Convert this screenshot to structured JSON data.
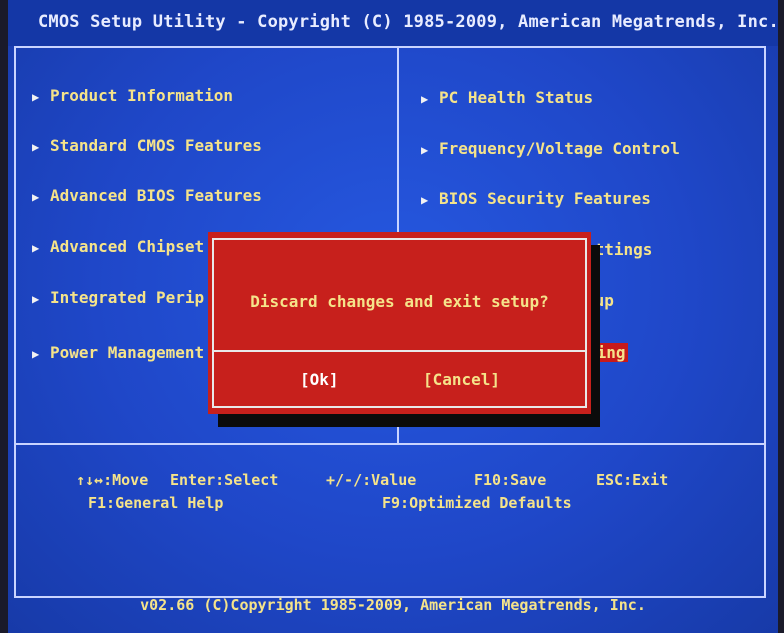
{
  "header": {
    "title": "CMOS Setup Utility - Copyright (C) 1985-2009, American Megatrends, Inc."
  },
  "left_menu": [
    {
      "label": "Product Information"
    },
    {
      "label": "Standard CMOS Features"
    },
    {
      "label": "Advanced BIOS Features"
    },
    {
      "label": "Advanced Chipset"
    },
    {
      "label": "Integrated Perip"
    },
    {
      "label": "Power Management"
    }
  ],
  "right_menu": [
    {
      "label": "PC Health Status"
    },
    {
      "label": "Frequency/Voltage Control"
    },
    {
      "label": "BIOS Security Features"
    },
    {
      "label": "ettings"
    },
    {
      "label": "tup"
    },
    {
      "label": "ving"
    }
  ],
  "dialog": {
    "message": "Discard changes and exit setup?",
    "ok_label": "[Ok]",
    "cancel_label": "[Cancel]"
  },
  "help": {
    "row1": {
      "move": "↑↓↔:Move",
      "select": "Enter:Select",
      "value": "+/-/:Value",
      "save": "F10:Save",
      "exit": "ESC:Exit"
    },
    "row2": {
      "general_help": "F1:General Help",
      "defaults": "F9:Optimized Defaults"
    }
  },
  "footer": {
    "version": "v02.66 (C)Copyright 1985-2009, American Megatrends, Inc."
  },
  "colors": {
    "background": "#1e45c6",
    "menu_text": "#f5e38a",
    "dialog": "#c7201c",
    "selected": "#c61a1a"
  }
}
